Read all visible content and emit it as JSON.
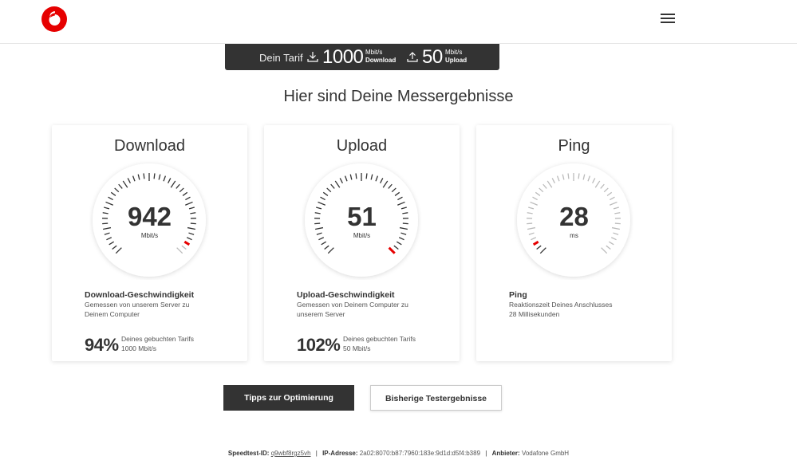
{
  "tarif": {
    "label": "Dein Tarif",
    "download_value": "1000",
    "download_unit_line1": "Mbit/s",
    "download_unit_line2": "Download",
    "upload_value": "50",
    "upload_unit_line1": "Mbit/s",
    "upload_unit_line2": "Upload"
  },
  "headline": "Hier sind Deine Messergebnisse",
  "cards": [
    {
      "title": "Download",
      "value": "942",
      "unit": "Mbit/s",
      "gauge_fraction": 0.94,
      "info_title": "Download-Geschwindigkeit",
      "info_line1": "Gemessen von unserem Server zu",
      "info_line2": "Deinem Computer",
      "percent": "94%",
      "percent_line1": "Deines gebuchten Tarifs",
      "percent_line2": "1000 Mbit/s"
    },
    {
      "title": "Upload",
      "value": "51",
      "unit": "Mbit/s",
      "gauge_fraction": 1.0,
      "info_title": "Upload-Geschwindigkeit",
      "info_line1": "Gemessen von Deinem Computer zu",
      "info_line2": "unserem Server",
      "percent": "102%",
      "percent_line1": "Deines gebuchten Tarifs",
      "percent_line2": "50 Mbit/s"
    },
    {
      "title": "Ping",
      "value": "28",
      "unit": "ms",
      "gauge_fraction": 0.06,
      "info_title": "Ping",
      "info_line1": "Reaktionszeit Deines Anschlusses",
      "info_line2": "28 Millisekunden"
    }
  ],
  "buttons": {
    "tips": "Tipps zur Optimierung",
    "history": "Bisherige Testergebnisse"
  },
  "footer": {
    "speedtest_label": "Speedtest-ID:",
    "speedtest_id": "q9wbf8rgz5vh",
    "ip_label": "IP-Adresse:",
    "ip_value": "2a02:8070:b87:7960:183e:9d1d:d5f4:b389",
    "provider_label": "Anbieter:",
    "provider_value": "Vodafone GmbH"
  },
  "colors": {
    "brand_red": "#e60000",
    "dark": "#333333"
  }
}
